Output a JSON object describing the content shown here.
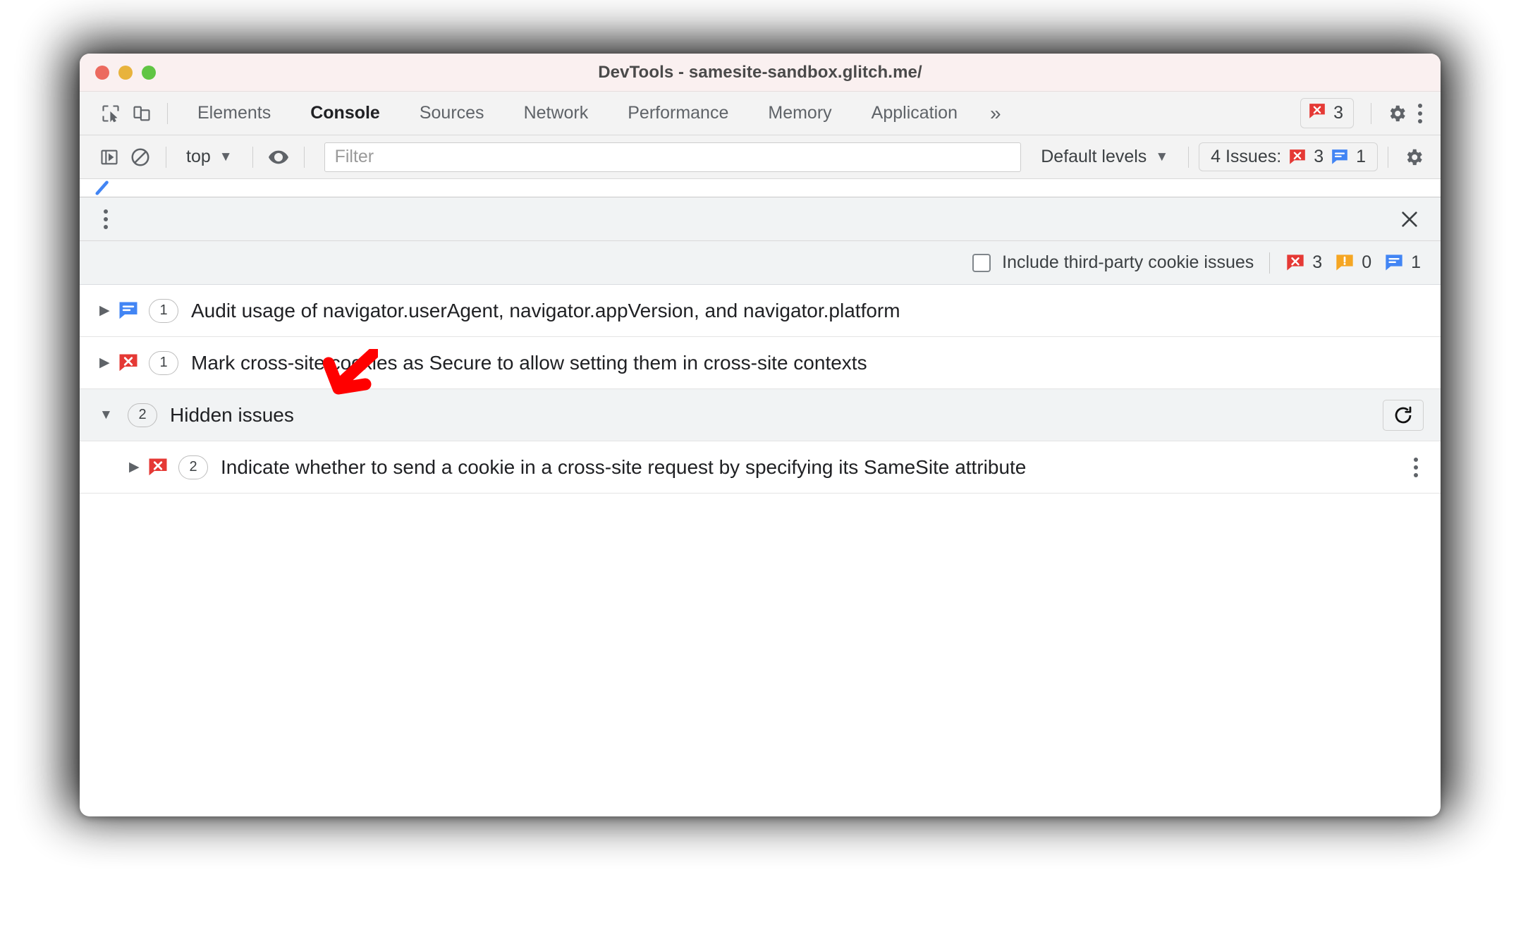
{
  "window": {
    "title": "DevTools - samesite-sandbox.glitch.me/",
    "traffic_lights": [
      "close",
      "minimize",
      "zoom"
    ],
    "colors": {
      "titlebar_bg": "#faf0f0",
      "toolbar_bg": "#f3f3f3",
      "panel_bg": "#f1f3f4",
      "error_red": "#e53935",
      "info_blue": "#4285f4",
      "warning_orange": "#f5a623",
      "annotation_red": "#ff0000"
    }
  },
  "tabbar": {
    "icons": [
      {
        "name": "inspect-element-icon"
      },
      {
        "name": "device-toolbar-icon"
      }
    ],
    "tabs": [
      {
        "label": "Elements",
        "active": false
      },
      {
        "label": "Console",
        "active": true
      },
      {
        "label": "Sources",
        "active": false
      },
      {
        "label": "Network",
        "active": false
      },
      {
        "label": "Performance",
        "active": false
      },
      {
        "label": "Memory",
        "active": false
      },
      {
        "label": "Application",
        "active": false
      }
    ],
    "more_tabs_label": "»",
    "error_pill": {
      "icon": "error-icon",
      "count": "3"
    },
    "settings_icon": "gear-icon",
    "menu_icon": "kebab-menu-icon"
  },
  "consolebar": {
    "sidebar_toggle_icon": "console-sidebar-icon",
    "clear_console_icon": "clear-console-icon",
    "context_label": "top",
    "context_caret": "▼",
    "live_expression_icon": "eye-icon",
    "filter_placeholder": "Filter",
    "filter_value": "",
    "levels_label": "Default levels",
    "levels_caret": "▼",
    "issues_pill": {
      "label": "4 Issues:",
      "error_icon": "error-icon",
      "error_count": "3",
      "info_icon": "info-icon",
      "info_count": "1"
    },
    "settings_icon": "gear-icon"
  },
  "issues_panel": {
    "header": {
      "menu_icon": "kebab-menu-icon",
      "close_icon": "close-icon"
    },
    "toolbar": {
      "checkbox_label": "Include third-party cookie issues",
      "checkbox_checked": false,
      "counts": [
        {
          "icon": "error-icon",
          "value": "3"
        },
        {
          "icon": "warning-icon",
          "value": "0"
        },
        {
          "icon": "info-icon",
          "value": "1"
        }
      ]
    },
    "rows": [
      {
        "kind": "issue",
        "caret": "▶",
        "expanded": false,
        "icon": "info-icon",
        "count": "1",
        "title": "Audit usage of navigator.userAgent, navigator.appVersion, and navigator.platform"
      },
      {
        "kind": "issue",
        "caret": "▶",
        "expanded": false,
        "icon": "error-icon",
        "count": "1",
        "title": "Mark cross-site cookies as Secure to allow setting them in cross-site contexts"
      },
      {
        "kind": "group",
        "caret": "▼",
        "expanded": true,
        "count": "2",
        "title": "Hidden issues",
        "refresh_icon": "refresh-icon"
      },
      {
        "kind": "issue-nested",
        "caret": "▶",
        "expanded": false,
        "icon": "error-icon",
        "count": "2",
        "title": "Indicate whether to send a cookie in a cross-site request by specifying its SameSite attribute",
        "menu_icon": "kebab-menu-icon"
      }
    ]
  },
  "annotation": {
    "arrow": "red-arrow-pointing-down-left",
    "color": "#ff0000"
  }
}
